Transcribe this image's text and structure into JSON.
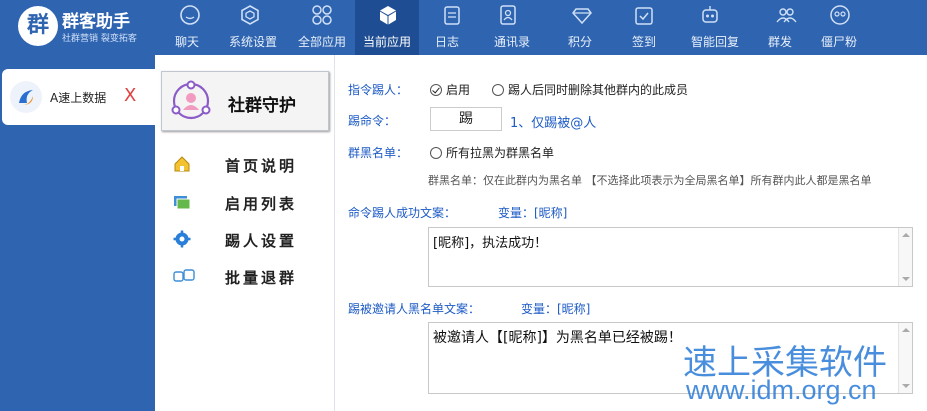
{
  "app": {
    "logo_mark": "群",
    "title": "群客助手",
    "subtitle": "社群营销 裂变拓客"
  },
  "nav": [
    {
      "label": "聊天",
      "icon": "chat-icon"
    },
    {
      "label": "系统设置",
      "icon": "hexagon-settings-icon"
    },
    {
      "label": "全部应用",
      "icon": "apps-grid-icon"
    },
    {
      "label": "当前应用",
      "icon": "cube-icon",
      "active": true
    },
    {
      "label": "日志",
      "icon": "log-icon"
    },
    {
      "label": "通讯录",
      "icon": "contacts-icon"
    },
    {
      "label": "积分",
      "icon": "diamond-icon"
    },
    {
      "label": "签到",
      "icon": "checkin-icon"
    },
    {
      "label": "智能回复",
      "icon": "robot-icon"
    },
    {
      "label": "群发",
      "icon": "group-send-icon"
    },
    {
      "label": "僵尸粉",
      "icon": "zombie-icon"
    }
  ],
  "account": {
    "name": "A速上数据",
    "close": "X"
  },
  "module": {
    "title": "社群守护",
    "menu": [
      {
        "label": "首页说明",
        "icon": "home-icon"
      },
      {
        "label": "启用列表",
        "icon": "list-icon"
      },
      {
        "label": "踢人设置",
        "icon": "gear-icon"
      },
      {
        "label": "批量退群",
        "icon": "exit-group-icon"
      }
    ]
  },
  "settings": {
    "cmd_label": "指令踢人：",
    "enable_label": "启用",
    "enable_checked": true,
    "remove_all_label": "踢人后同时删除其他群内的此成员",
    "kick_cmd_label": "踢命令：",
    "kick_cmd_value": "踢",
    "kick_cmd_note": "1、仅踢被@人",
    "blacklist_label": "群黑名单：",
    "blacklist_option": "所有拉黑为群黑名单",
    "blacklist_hint": "群黑名单：仅在此群内为黑名单 【不选择此项表示为全局黑名单】所有群内此人都是黑名单",
    "success_text_label": "命令踢人成功文案：",
    "success_var_label": "变量：[昵称]",
    "success_text_value": "[昵称]，执法成功！",
    "invite_text_label": "踢被邀请人黑名单文案：",
    "invite_var_label": "变量：[昵称]",
    "invite_text_value": "被邀请人【[昵称]】为黑名单已经被踢！"
  },
  "watermark": {
    "line1": "速上采集软件",
    "line2": "www.idm.org.cn"
  },
  "colors": {
    "primary": "#2f64b0",
    "active_tab": "#1f4d93",
    "label_blue": "#1d5bc5"
  }
}
